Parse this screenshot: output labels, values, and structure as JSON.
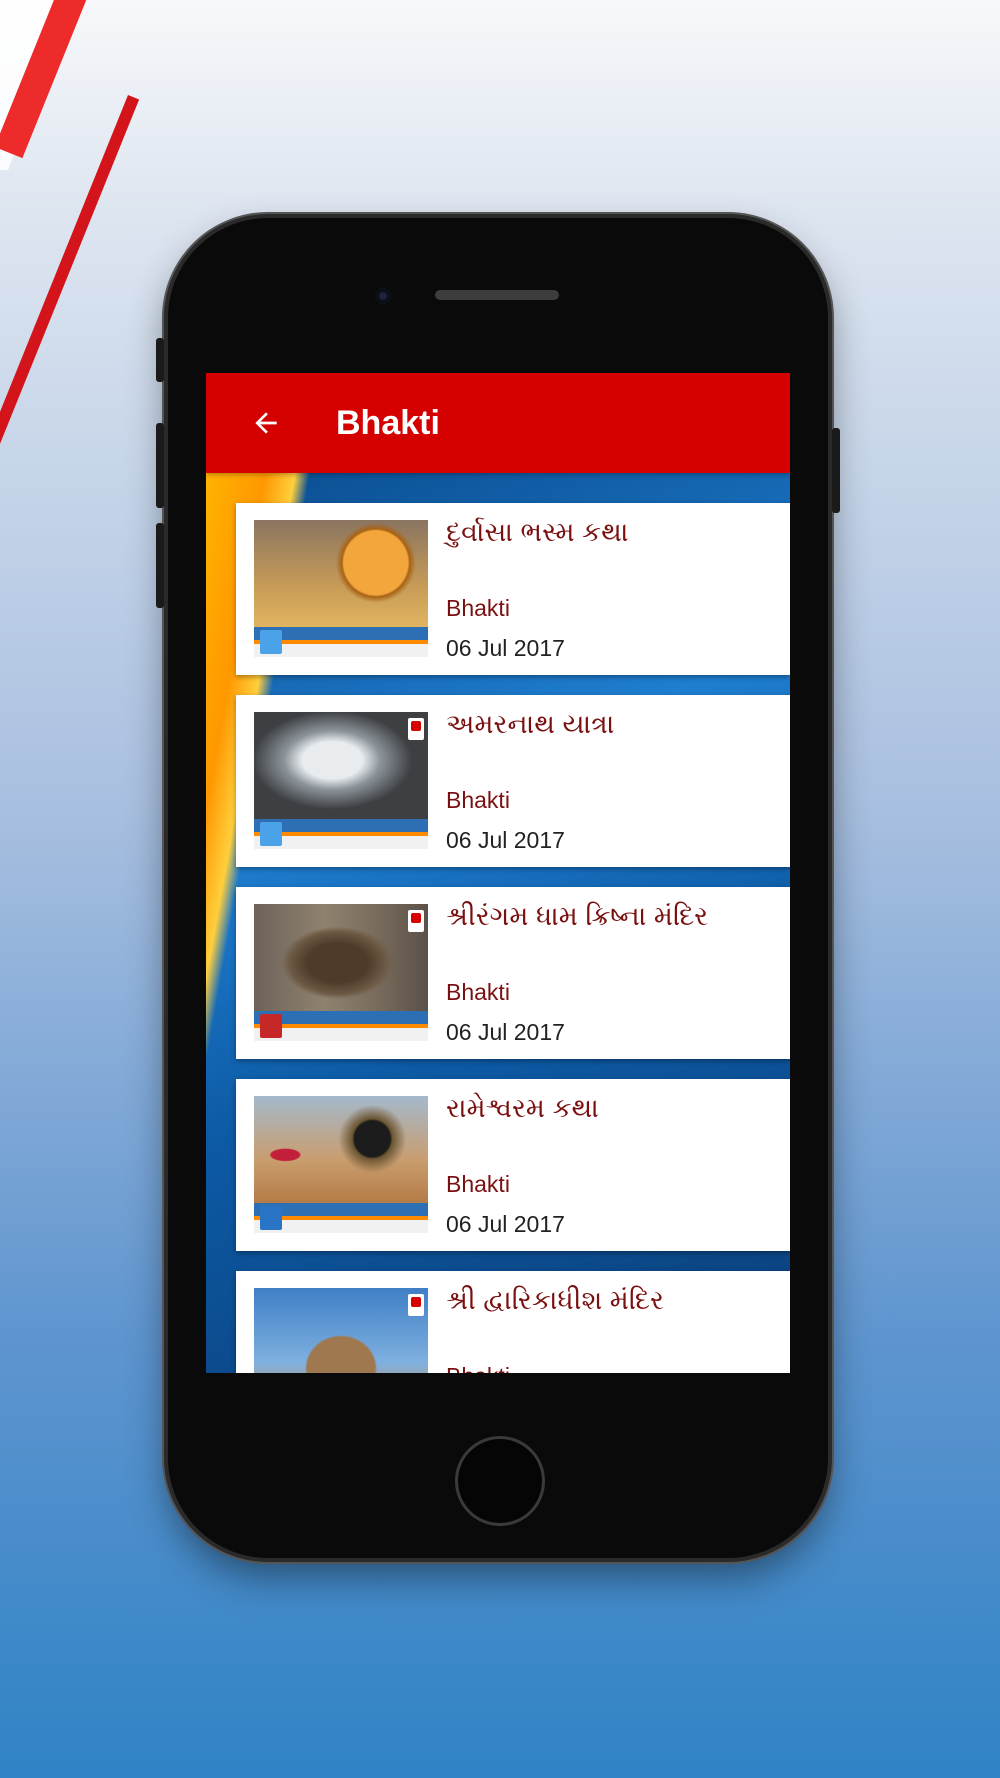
{
  "appbar": {
    "title": "Bhakti"
  },
  "items": [
    {
      "title": "દુર્વાસા ભસ્મ કથા",
      "category": "Bhakti",
      "date": "06 Jul 2017"
    },
    {
      "title": "અમરનાથ યાત્રા",
      "category": "Bhakti",
      "date": "06 Jul 2017"
    },
    {
      "title": "શ્રીરંગમ ધામ ક્રિષ્ના મંદિર",
      "category": "Bhakti",
      "date": "06 Jul 2017"
    },
    {
      "title": "રામેશ્વરમ કથા",
      "category": "Bhakti",
      "date": "06 Jul 2017"
    },
    {
      "title": "શ્રી દ્વારિકાધીશ મંદિર",
      "category": "Bhakti",
      "date": ""
    }
  ],
  "colors": {
    "appbar": "#d50000",
    "title_text": "#7a1010"
  },
  "icons": {
    "back": "arrow-left-icon"
  }
}
